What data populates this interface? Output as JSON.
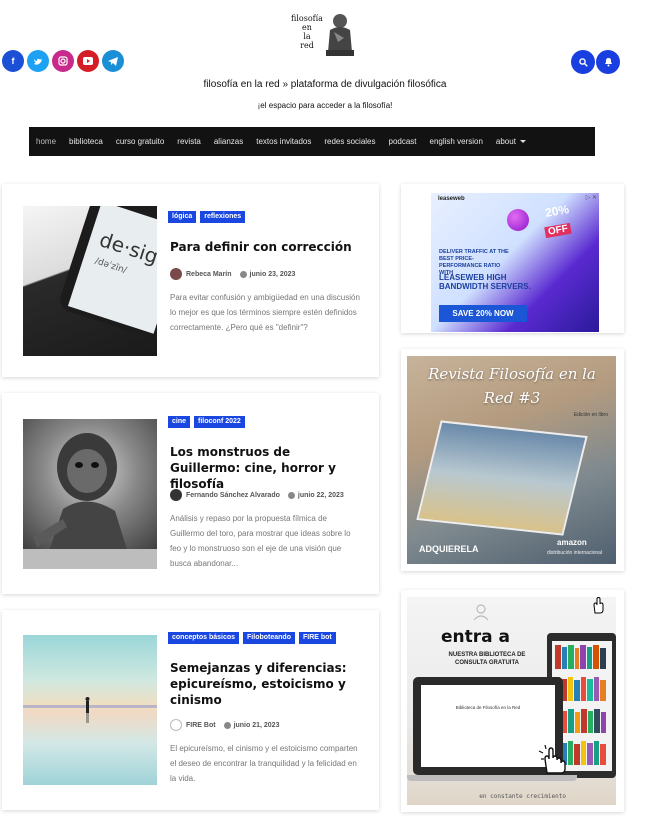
{
  "header": {
    "logo_lines": [
      "filosofía",
      "en",
      "la",
      "red"
    ],
    "tagline": "filosofía en la red » plataforma de divulgación filosófica",
    "subline": "¡el espacio para acceder a la filosofía!",
    "social": [
      "facebook-icon",
      "twitter-icon",
      "instagram-icon",
      "youtube-icon",
      "telegram-icon"
    ],
    "accent": "#1a3fe0"
  },
  "nav": {
    "items": [
      "home",
      "biblioteca",
      "curso gratuito",
      "revista",
      "alianzas",
      "textos invitados",
      "redes sociales",
      "podcast",
      "english version",
      "about"
    ]
  },
  "posts": [
    {
      "tags": [
        "lógica",
        "reflexiones"
      ],
      "title": "Para definir con corrección",
      "author": "Rebeca Marín",
      "date": "junio 23, 2023",
      "excerpt": "Para evitar confusión y ambigüedad en una discusión lo mejor es que los términos siempre estén definidos correctamente. ¿Pero qué es \"definir\"?"
    },
    {
      "tags": [
        "cine",
        "filoconf 2022"
      ],
      "title": "Los monstruos de Guillermo: cine, horror y filosofía",
      "author": "Fernando Sánchez Alvarado",
      "date": "junio 22, 2023",
      "excerpt": "Análisis y repaso por la propuesta fílmica de Guillermo del toro, para mostrar que ideas sobre lo feo y lo monstruoso son el eje de una visión que busca abandonar..."
    },
    {
      "tags": [
        "conceptos básicos",
        "Filoboteando",
        "FIRE bot"
      ],
      "title": "Semejanzas y diferencias: epicureísmo, estoicismo y cinismo",
      "author": "FIRE Bot",
      "date": "junio 21, 2023",
      "excerpt": "El epicureísmo, el cinismo y el estoicismo comparten el deseo de encontrar la tranquilidad y la felicidad en la vida."
    }
  ],
  "sidebar": {
    "ad": {
      "brand": "leaseweb",
      "corner": "▷ ✕",
      "line1": "DELIVER TRAFFIC AT THE BEST PRICE-PERFORMANCE RATIO WITH",
      "line2": "LEASEWEB HIGH BANDWIDTH SERVERS.",
      "button": "SAVE 20% NOW",
      "badge": "20%",
      "off": "OFF"
    },
    "magazine": {
      "title": "Revista Filosofía en la Red #3",
      "subtitle": "Edición en libro",
      "cta": "ADQUIERELA",
      "store": "amazon",
      "store_note": "distribución internacional"
    },
    "library": {
      "heading": "entra a",
      "sub": "NUESTRA BIBLIOTECA DE CONSULTA GRATUITA",
      "screen_title": "Biblioteca de Filosofía en la Red",
      "footer": "en constante crecimiento"
    }
  }
}
